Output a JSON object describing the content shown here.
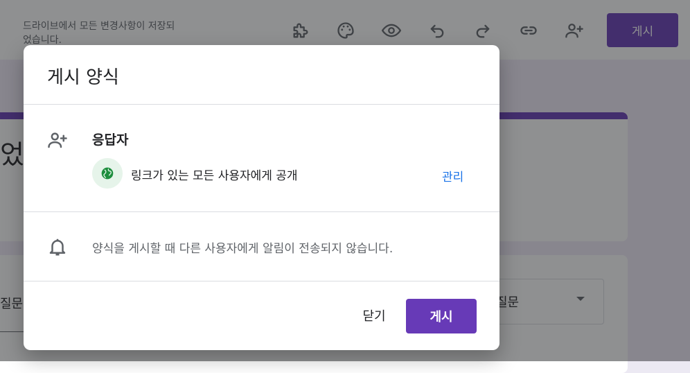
{
  "app": {
    "save_status": "드라이브에서 모든 변경사항이 저장되었습니다.",
    "publish_label": "게시",
    "toolbar_icons": [
      "puzzle-icon",
      "palette-icon",
      "eye-icon",
      "undo-icon",
      "redo-icon",
      "link-icon",
      "add-person-icon"
    ],
    "form_title_fragment": "었는",
    "question_fragment": "질문",
    "question_type": "질문"
  },
  "dialog": {
    "title": "게시 양식",
    "respondents": {
      "heading": "응답자",
      "access": "링크가 있는 모든 사용자에게 공개",
      "manage_label": "관리"
    },
    "notice": "양식을 게시할 때 다른 사용자에게 알림이 전송되지 않습니다.",
    "close_label": "닫기",
    "publish_label": "게시"
  },
  "colors": {
    "accent": "#673ab7",
    "link": "#1a73e8",
    "globe": "#1e8e3e"
  }
}
